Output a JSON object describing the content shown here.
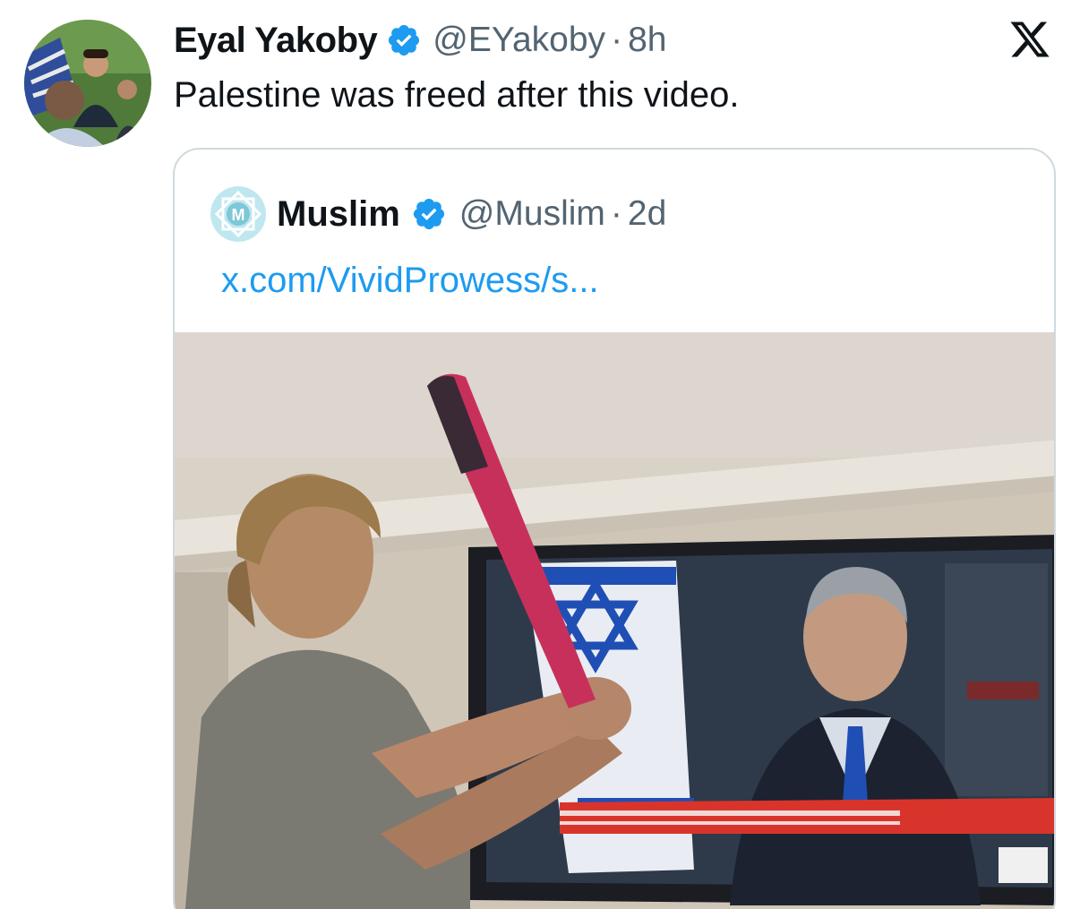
{
  "tweet": {
    "author_name": "Eyal Yakoby",
    "handle": "@EYakoby",
    "separator": "·",
    "time": "8h",
    "text": "Palestine was freed after this video.",
    "verified_icon": "verified-badge-icon",
    "platform_icon": "x-logo-icon"
  },
  "quote": {
    "author_name": "Muslim",
    "handle": "@Muslim",
    "separator": "·",
    "time": "2d",
    "link": "x.com/VividProwess/s...",
    "avatar_letter": "M",
    "verified_icon": "verified-badge-icon"
  },
  "colors": {
    "verified_blue": "#1d9bf0",
    "link_blue": "#1d9bf0",
    "muted_text": "#536471",
    "border": "#cfd9de"
  }
}
